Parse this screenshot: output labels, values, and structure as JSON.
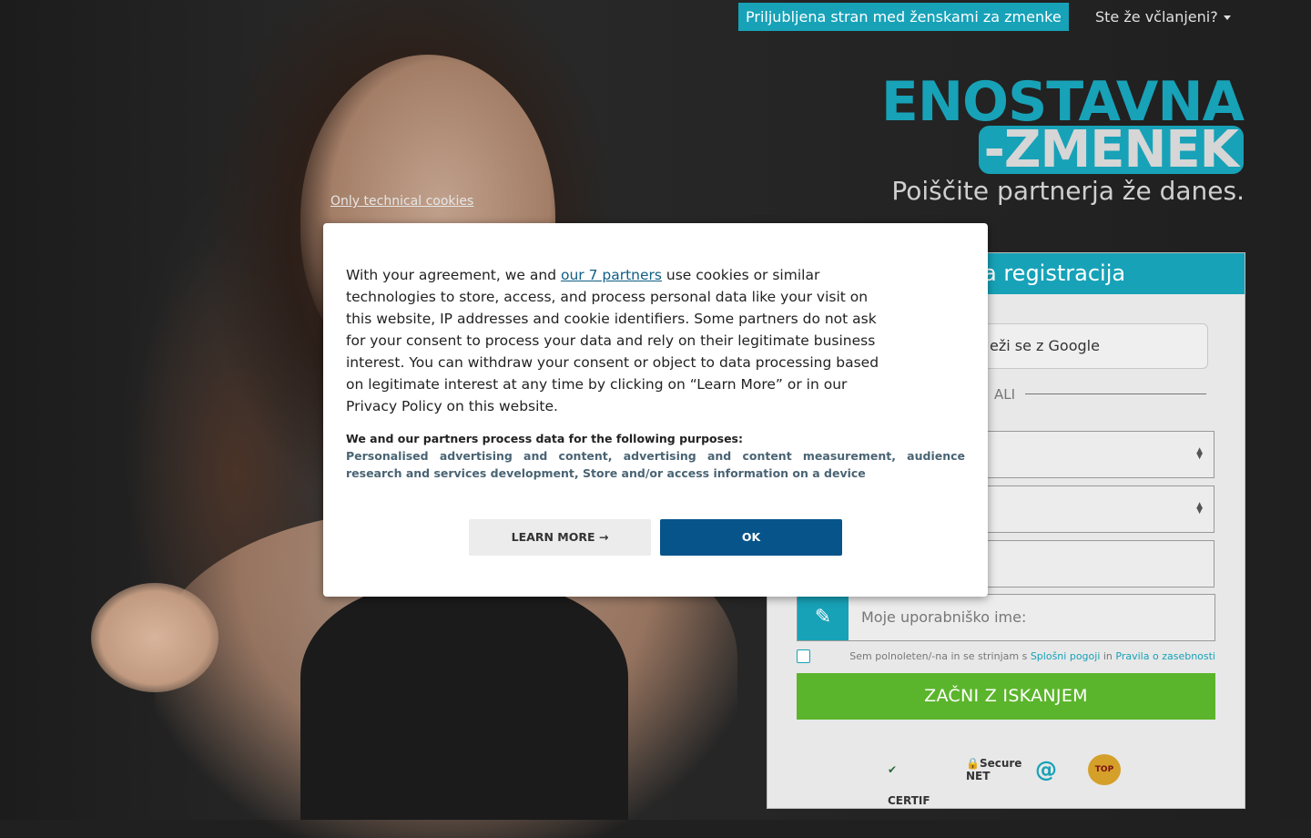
{
  "header": {
    "top_link": "Priljubljena stran med ženskami za zmenke",
    "member_toggle": "Ste že včlanjeni?"
  },
  "logo": {
    "line1": "ENOSTAVNA",
    "line2": "-ZMENEK",
    "tagline": "Poiščite partnerja že danes."
  },
  "form": {
    "header_partial": "a registracija",
    "google_partial": "eži se z Google",
    "or_label": "ALI",
    "username_placeholder": "Moje uporabniško ime:",
    "terms_prefix": "Sem polnoleten/-na in se strinjam s",
    "terms_link1": "Splošni pogoji",
    "terms_and": "in",
    "terms_link2": "Pravila o zasebnosti",
    "start_button": "ZAČNI Z ISKANJEM",
    "badges": [
      "CERTIF",
      "Secure NET",
      "@",
      "TOP"
    ]
  },
  "cookie": {
    "only_technical": "Only technical cookies",
    "intro_before": "With your agreement, we and ",
    "partners_link": "our 7 partners",
    "intro_after": " use cookies or similar technologies to store, access, and process personal data like your visit on this website, IP addresses and cookie identifiers. Some partners do not ask for your consent to process your data and rely on their legitimate business interest. You can withdraw your consent or object to data processing based on legitimate interest at any time by clicking on “Learn More” or in our Privacy Policy on this website.",
    "purposes_title": "We and our partners process data for the following purposes:",
    "purposes": "Personalised advertising and content, advertising and content measurement, audience research and services development, Store and/or access information on a device",
    "learn_more": "LEARN MORE →",
    "ok": "OK"
  },
  "colors": {
    "accent": "#17a2b8",
    "start_button": "#5bb52c",
    "ok_button": "#06548a"
  }
}
